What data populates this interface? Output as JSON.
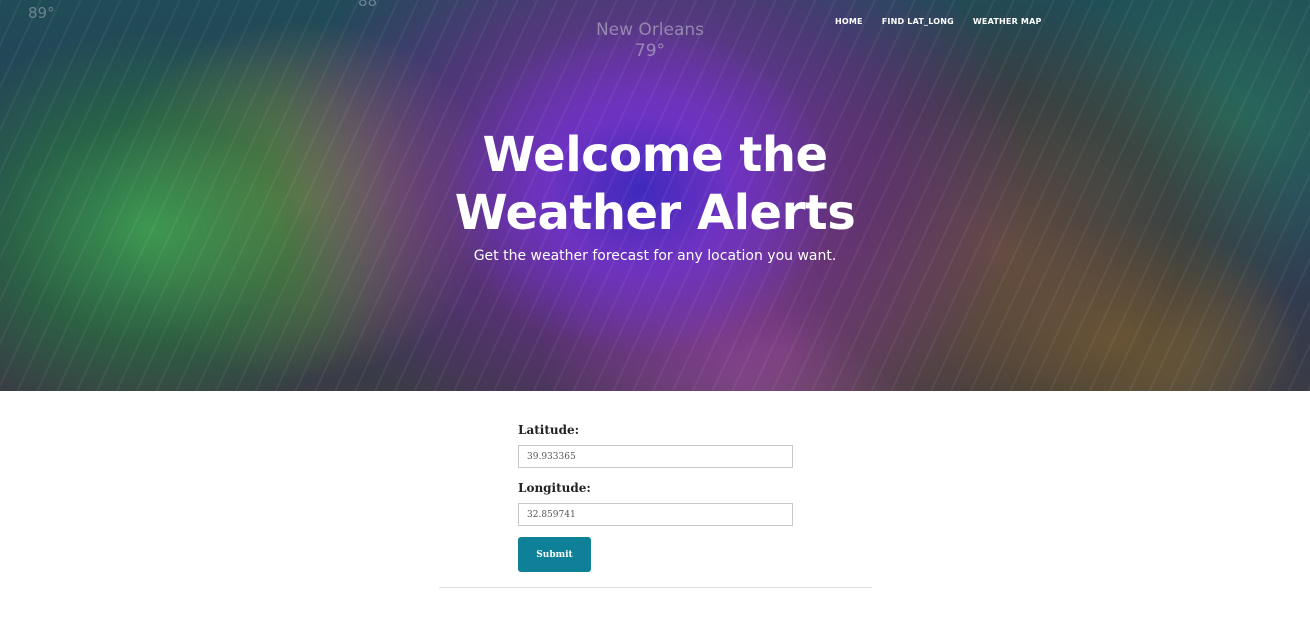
{
  "nav": {
    "items": [
      {
        "label": "HOME"
      },
      {
        "label": "FIND LAT_LONG"
      },
      {
        "label": "WEATHER MAP"
      }
    ]
  },
  "map": {
    "city": "New Orleans",
    "city_temp": "79°",
    "temp_left": "89°",
    "temp_mid": "88"
  },
  "hero": {
    "title": "Welcome the Weather Alerts",
    "subtitle": "Get the weather forecast for any location you want."
  },
  "form": {
    "latitude_label": "Latitude:",
    "latitude_value": "39.933365",
    "longitude_label": "Longitude:",
    "longitude_value": "32.859741",
    "submit_label": "Submit"
  },
  "colors": {
    "accent": "#0e8199",
    "divider": "#e1e1e1"
  }
}
